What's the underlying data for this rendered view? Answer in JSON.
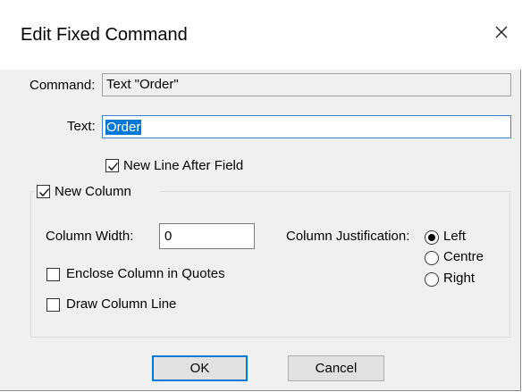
{
  "dialog": {
    "title": "Edit Fixed Command"
  },
  "command": {
    "label": "Command:",
    "value": "Text \"Order\""
  },
  "text_field": {
    "label": "Text:",
    "value": "Order"
  },
  "new_line_after_field": {
    "label": "New Line After Field",
    "checked": true
  },
  "new_column": {
    "label": "New Column",
    "checked": true,
    "column_width": {
      "label": "Column Width:",
      "value": "0"
    },
    "enclose_in_quotes": {
      "label": "Enclose Column in Quotes",
      "checked": false
    },
    "draw_column_line": {
      "label": "Draw Column Line",
      "checked": false
    },
    "justification": {
      "label": "Column Justification:",
      "options": [
        "Left",
        "Centre",
        "Right"
      ],
      "selected": "Left"
    }
  },
  "buttons": {
    "ok": "OK",
    "cancel": "Cancel"
  },
  "colors": {
    "selection": "#0078d7",
    "dialog_bg": "#f0f0f0"
  }
}
